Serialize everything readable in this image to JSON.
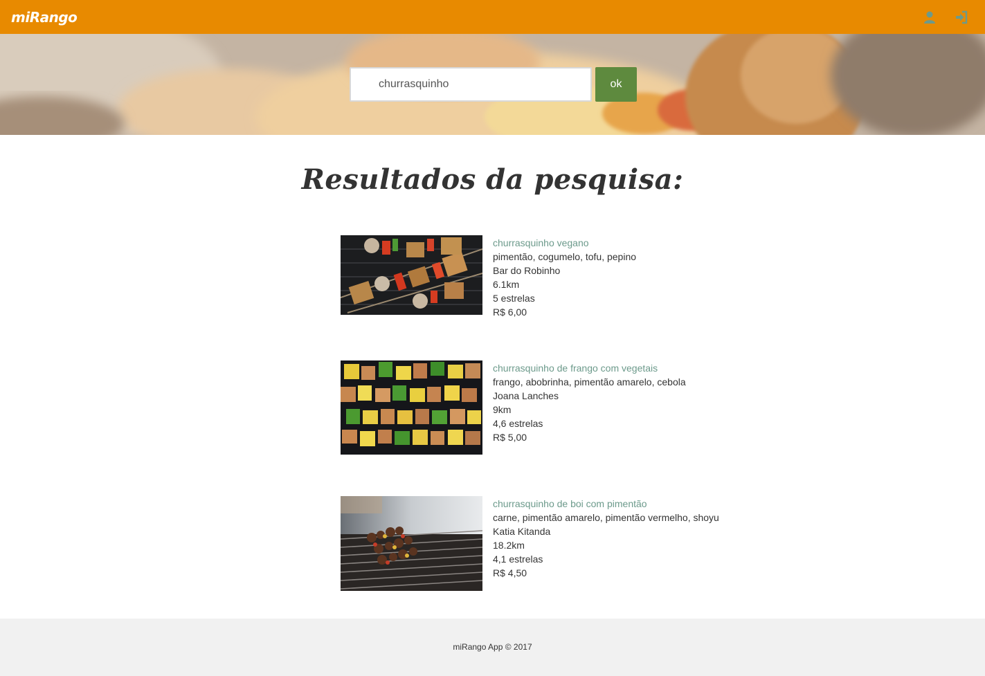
{
  "navbar": {
    "brand": "miRango",
    "icons": [
      "user-icon",
      "sign-in-icon"
    ]
  },
  "search": {
    "value": "churrasquinho",
    "button_label": "ok"
  },
  "results": {
    "title": "Resultados da pesquisa:",
    "items": [
      {
        "name": "churrasquinho vegano",
        "ingredients": "pimentão, cogumelo, tofu, pepino",
        "place": "Bar do Robinho",
        "distance": "6.1km",
        "rating": "5 estrelas",
        "price": "R$ 6,00"
      },
      {
        "name": "churrasquinho de frango com vegetais",
        "ingredients": "frango, abobrinha, pimentão amarelo, cebola",
        "place": "Joana Lanches",
        "distance": "9km",
        "rating": "4,6 estrelas",
        "price": "R$ 5,00"
      },
      {
        "name": "churrasquinho de boi com pimentão",
        "ingredients": "carne, pimentão amarelo, pimentão vermelho, shoyu",
        "place": "Katia Kitanda",
        "distance": "18.2km",
        "rating": "4,1 estrelas",
        "price": "R$ 4,50"
      }
    ]
  },
  "footer": {
    "text": "miRango App © 2017"
  },
  "colors": {
    "navbar": "#e88a00",
    "ok_button": "#5e8a3e",
    "dish_link": "#6c9a8b",
    "footer_bg": "#f1f1f1"
  }
}
